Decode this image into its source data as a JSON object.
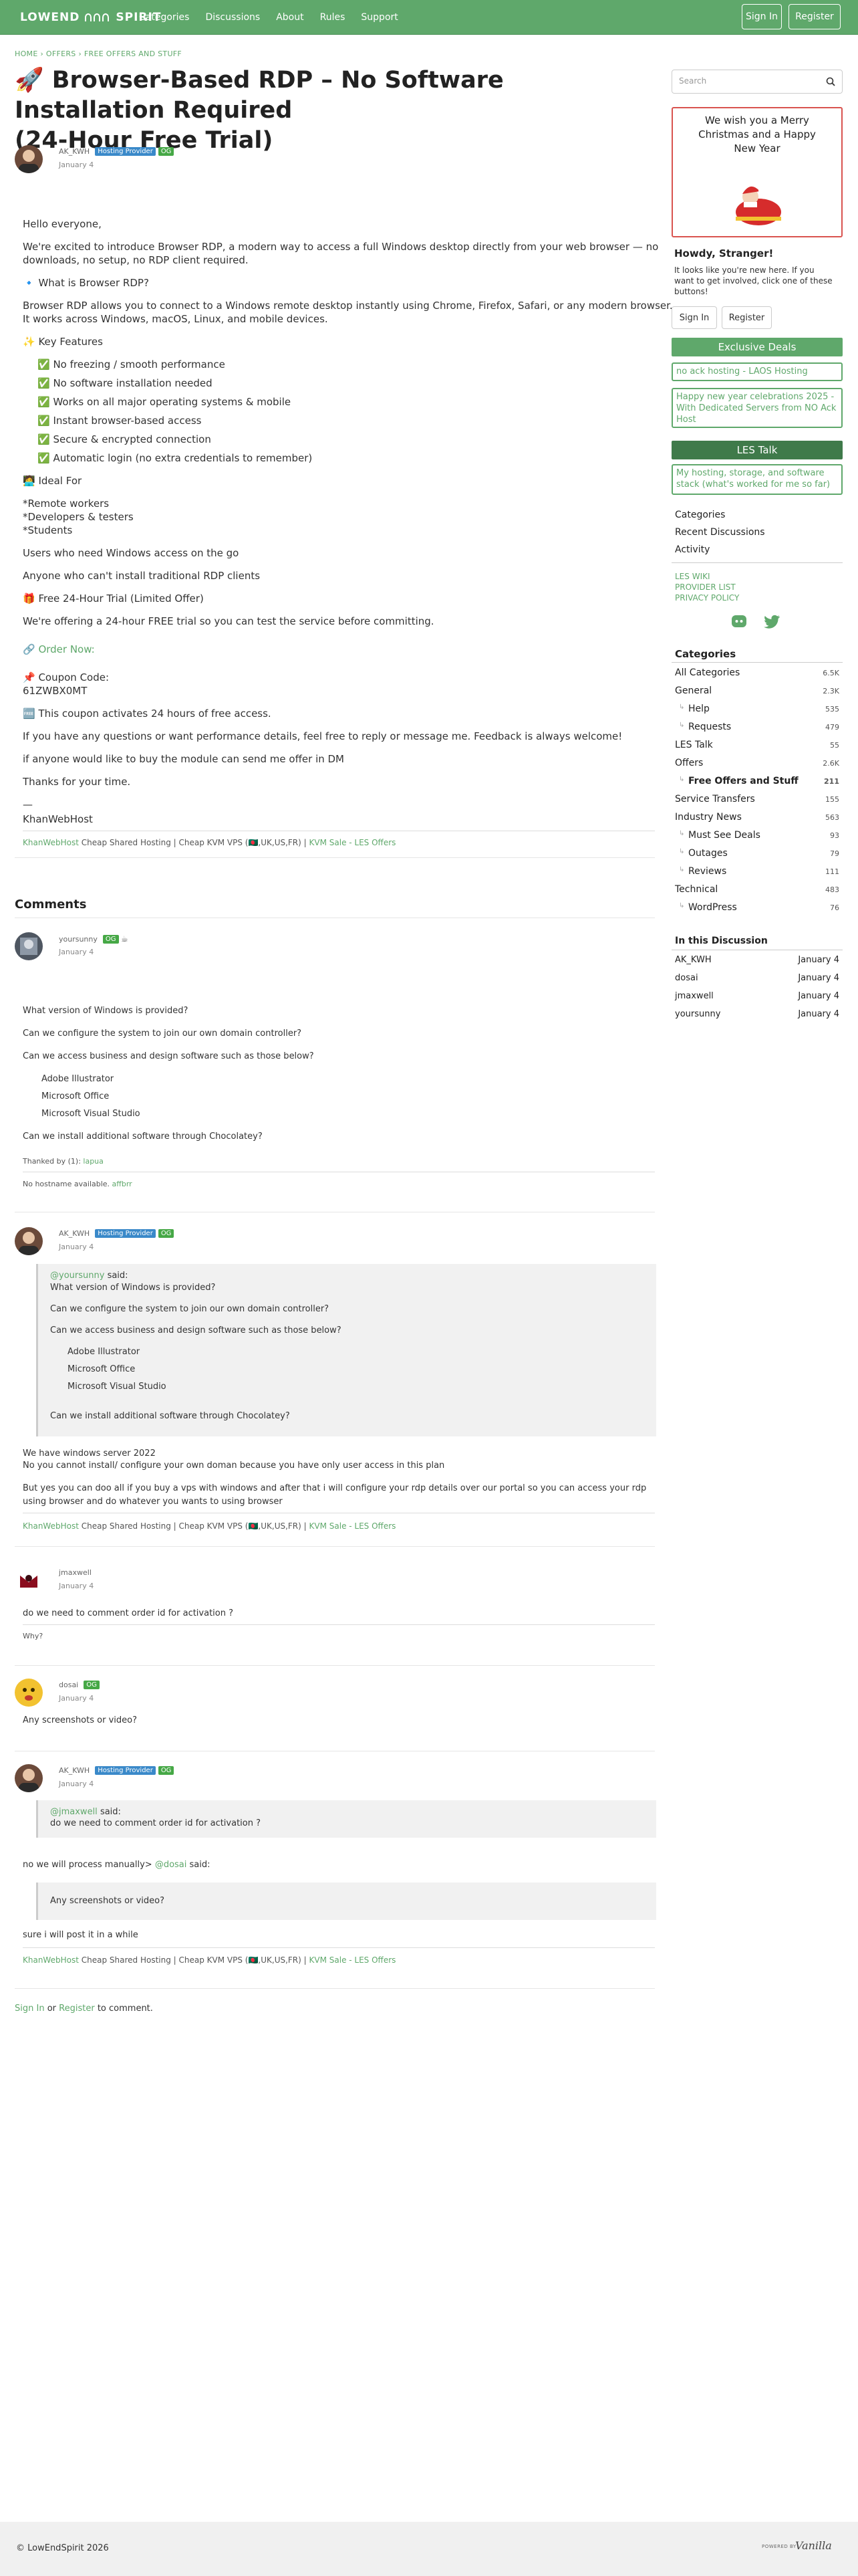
{
  "brand": {
    "name_left": "LOWEND",
    "name_right": "SPIRIT"
  },
  "nav": [
    "Categories",
    "Discussions",
    "About",
    "Rules",
    "Support"
  ],
  "header_buttons": {
    "signin": "Sign In",
    "register": "Register"
  },
  "breadcrumbs": {
    "home": "HOME",
    "sep1": "›",
    "offers": "OFFERS",
    "sep2": "›",
    "free": "FREE OFFERS AND STUFF"
  },
  "post": {
    "title_line1": "🚀 Browser-Based RDP – No Software Installation Required",
    "title_line2": "(24-Hour Free Trial)",
    "author": "AK_KWH",
    "date": "January 4",
    "badge_hp": "Hosting Provider",
    "badge_og": "OG",
    "lines": [
      "Hello everyone,",
      "We're excited to introduce Browser RDP, a modern way to access a full Windows desktop directly from your web browser — no",
      "downloads, no setup, no RDP client required.",
      "🔹 What is Browser RDP?",
      "Browser RDP allows you to connect to a Windows remote desktop instantly using Chrome, Firefox, Safari, or any modern browser.",
      "It works across Windows, macOS, Linux, and mobile devices.",
      "✨ Key Features",
      "✅ No freezing / smooth performance",
      "✅ No software installation needed",
      "✅ Works on all major operating systems & mobile",
      "✅ Instant browser-based access",
      "✅ Secure & encrypted connection",
      "✅ Automatic login (no extra credentials to remember)",
      "🧑‍💻 Ideal For",
      "*Remote workers",
      "*Developers & testers",
      "*Students",
      "Users who need Windows access on the go",
      "Anyone who can't install traditional RDP clients",
      "🎁 Free 24-Hour Trial (Limited Offer)",
      "We're offering a 24-hour FREE trial so you can test the service before committing.",
      "🔗 Order Now:",
      "📌 Coupon Code:",
      "61ZWBX0MT",
      "🆓 This coupon activates 24 hours of free access.",
      "If you have any questions or want performance details, feel free to reply or message me. Feedback is always welcome!",
      "if anyone would like to buy the module can send me offer in DM",
      "Thanks for your time.",
      "—",
      "KhanWebHost"
    ]
  },
  "signature": {
    "link1": "KhanWebHost",
    "text": "Cheap Shared Hosting | Cheap KVM VPS (🇧🇩,UK,US,FR) |",
    "link2": "KVM Sale - LES Offers"
  },
  "comments_heading": "Comments",
  "comments": [
    {
      "author": "yoursunny",
      "date": "January 4",
      "badge_og": "OG",
      "lines": [
        "What version of Windows is provided?",
        "Can we configure the system to join our own domain controller?",
        "Can we access business and design software such as those below?",
        "Adobe Illustrator",
        "Microsoft Office",
        "Microsoft Visual Studio",
        "Can we install additional software through Chocolatey?"
      ],
      "thanked_label": "Thanked by (1):",
      "thanked_user": "lapua",
      "sig_text": "No hostname available.",
      "sig_link": "affbrr"
    },
    {
      "author": "AK_KWH",
      "date": "January 4",
      "badge_hp": "Hosting Provider",
      "badge_og": "OG",
      "quote_user": "@yoursunny",
      "quote_said": "said:",
      "quote_lines": [
        "What version of Windows is provided?",
        "Can we configure the system to join our own domain controller?",
        "Can we access business and design software such as those below?",
        "Adobe Illustrator",
        "Microsoft Office",
        "Microsoft Visual Studio",
        "Can we install additional software through Chocolatey?"
      ],
      "lines": [
        "We have windows server 2022",
        "No you cannot install/ configure your own doman because you have only user access in this plan",
        "But yes you can doo all if you buy a vps with windows and after that i will configure your rdp details over our portal so you can access your rdp",
        "using browser and do whatever you wants to using browser"
      ]
    },
    {
      "author": "jmaxwell",
      "date": "January 4",
      "lines": [
        "do we need to comment order id for activation ?"
      ],
      "sig_text": "Why?"
    },
    {
      "author": "dosai",
      "date": "January 4",
      "badge_og": "OG",
      "lines": [
        "Any screenshots or video?"
      ]
    },
    {
      "author": "AK_KWH",
      "date": "January 4",
      "badge_hp": "Hosting Provider",
      "badge_og": "OG",
      "quote1_user": "@jmaxwell",
      "quote1_said": "said:",
      "quote1_line": "do we need to comment order id for activation ?",
      "mid_text": "no we will process manually>",
      "mid_user": "@dosai",
      "mid_said": "said:",
      "quote2_line": "Any screenshots or video?",
      "line_after": "sure i will post it in a while"
    }
  ],
  "comment_prompt": {
    "signin": "Sign In",
    "or": "or",
    "register": "Register",
    "rest": "to comment."
  },
  "sidebar": {
    "search_placeholder": "Search",
    "xmas": [
      "We wish you a Merry",
      "Christmas and a Happy",
      "New Year"
    ],
    "howdy": "Howdy, Stranger!",
    "howdy_text": [
      "It looks like you're new here. If you",
      "want to get involved, click one of these",
      "buttons!"
    ],
    "signin": "Sign In",
    "register": "Register",
    "exclusive": "Exclusive Deals",
    "promo1": "no ack hosting - LAOS Hosting",
    "promo2": "Happy new year celebrations 2025 - With Dedicated Servers from NO Ack Host",
    "les_talk": "LES Talk",
    "promo3": "My hosting, storage, and software stack (what's worked for me so far)",
    "links": [
      "Categories",
      "Recent Discussions",
      "Activity"
    ],
    "extra_links": [
      "LES WIKI",
      "PROVIDER LIST",
      "PRIVACY POLICY"
    ],
    "categories_heading": "Categories",
    "categories": [
      {
        "name": "All Categories",
        "n": "6.5K"
      },
      {
        "name": "General",
        "n": "2.3K"
      },
      {
        "name": "Help",
        "n": "535"
      },
      {
        "name": "Requests",
        "n": "479"
      },
      {
        "name": "LES Talk",
        "n": "55"
      },
      {
        "name": "Offers",
        "n": "2.6K"
      },
      {
        "name": "Free Offers and Stuff",
        "n": "211"
      },
      {
        "name": "Service Transfers",
        "n": "155"
      },
      {
        "name": "Industry News",
        "n": "563"
      },
      {
        "name": "Must See Deals",
        "n": "93"
      },
      {
        "name": "Outages",
        "n": "79"
      },
      {
        "name": "Reviews",
        "n": "111"
      },
      {
        "name": "Technical",
        "n": "483"
      },
      {
        "name": "WordPress",
        "n": "76"
      }
    ],
    "discussion_heading": "In this Discussion",
    "discussion": [
      {
        "user": "AK_KWH",
        "date": "January 4"
      },
      {
        "user": "dosai",
        "date": "January 4"
      },
      {
        "user": "jmaxwell",
        "date": "January 4"
      },
      {
        "user": "yoursunny",
        "date": "January 4"
      }
    ]
  },
  "footer": {
    "copyright": "© LowEndSpirit 2026",
    "powered": "POWERED BY",
    "vanilla": "Vanilla"
  },
  "colors": {
    "brand": "#5fa86b",
    "hosting_badge": "#3a89c9",
    "og_badge": "#46a846",
    "les_talk_bar": "#3f7a4a"
  }
}
